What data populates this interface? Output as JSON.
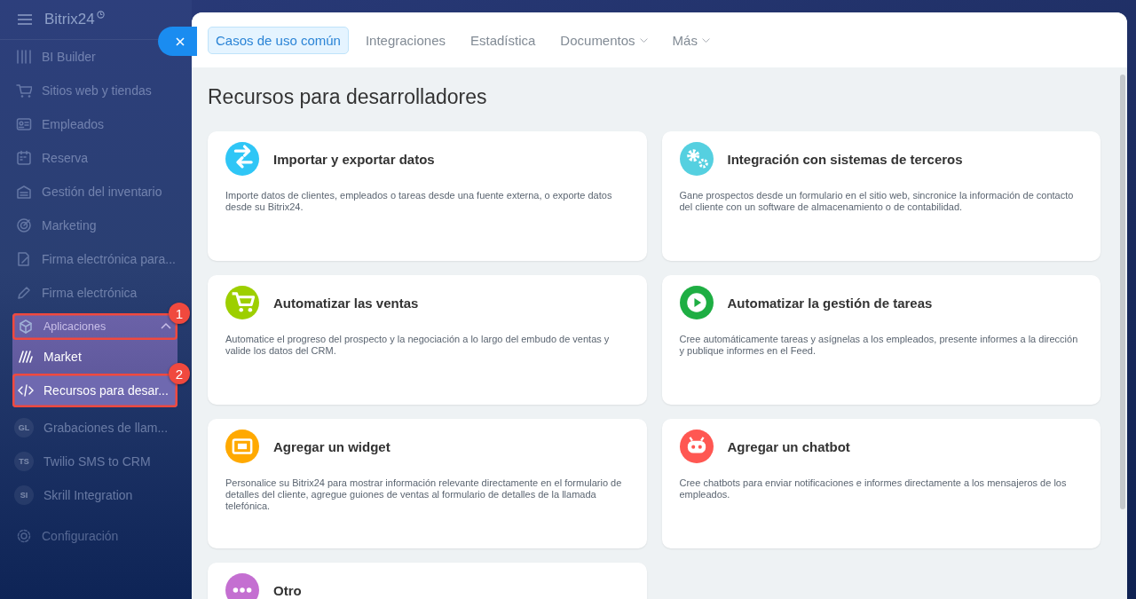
{
  "sidebar": {
    "logo": "Bitrix24",
    "items": [
      {
        "label": "BI Builder"
      },
      {
        "label": "Sitios web y tiendas"
      },
      {
        "label": "Empleados"
      },
      {
        "label": "Reserva"
      },
      {
        "label": "Gestión del inventario"
      },
      {
        "label": "Marketing"
      },
      {
        "label": "Firma electrónica para..."
      },
      {
        "label": "Firma electrónica"
      },
      {
        "label": "Aplicaciones",
        "expanded": true,
        "callout": "1",
        "children": [
          {
            "label": "Market",
            "selected": false
          },
          {
            "label": "Recursos para desar...",
            "selected": true,
            "callout": "2"
          }
        ]
      },
      {
        "label": "Grabaciones de llam...",
        "badge": "GL"
      },
      {
        "label": "Twilio SMS to CRM",
        "badge": "TS"
      },
      {
        "label": "Skrill Integration",
        "badge": "SI"
      },
      {
        "label": "Configuración"
      }
    ]
  },
  "tabs": [
    {
      "label": "Casos de uso común",
      "selected": true,
      "has_menu": false
    },
    {
      "label": "Integraciones",
      "selected": false,
      "has_menu": false
    },
    {
      "label": "Estadística",
      "selected": false,
      "has_menu": false
    },
    {
      "label": "Documentos",
      "selected": false,
      "has_menu": true
    },
    {
      "label": "Más",
      "selected": false,
      "has_menu": true
    }
  ],
  "page_title": "Recursos para desarrolladores",
  "cards": [
    {
      "title": "Importar y exportar datos",
      "color": "#2fc6f6",
      "description": "Importe datos de clientes, empleados o tareas desde una fuente externa, o exporte datos desde su Bitrix24."
    },
    {
      "title": "Integración con sistemas de terceros",
      "color": "#55d0e0",
      "description": "Gane prospectos desde un formulario en el sitio web, sincronice la información de contacto del cliente con un software de almacenamiento o de contabilidad."
    },
    {
      "title": "Automatizar las ventas",
      "color": "#9dcf00",
      "description": "Automatice el progreso del prospecto y la negociación a lo largo del embudo de ventas y valide los datos del CRM."
    },
    {
      "title": "Automatizar la gestión de tareas",
      "color": "#1eae43",
      "description": "Cree automáticamente tareas y asígnelas a los empleados, presente informes a la dirección y publique informes en el Feed."
    },
    {
      "title": "Agregar un widget",
      "color": "#ffa900",
      "description": "Personalice su Bitrix24 para mostrar información relevante directamente en el formulario de detalles del cliente, agregue guiones de ventas al formulario de detalles de la llamada telefónica."
    },
    {
      "title": "Agregar un chatbot",
      "color": "#ff5752",
      "description": "Cree chatbots para enviar notificaciones e informes directamente a los mensajeros de los empleados."
    },
    {
      "title": "Otro",
      "color": "#c46fd1"
    }
  ]
}
